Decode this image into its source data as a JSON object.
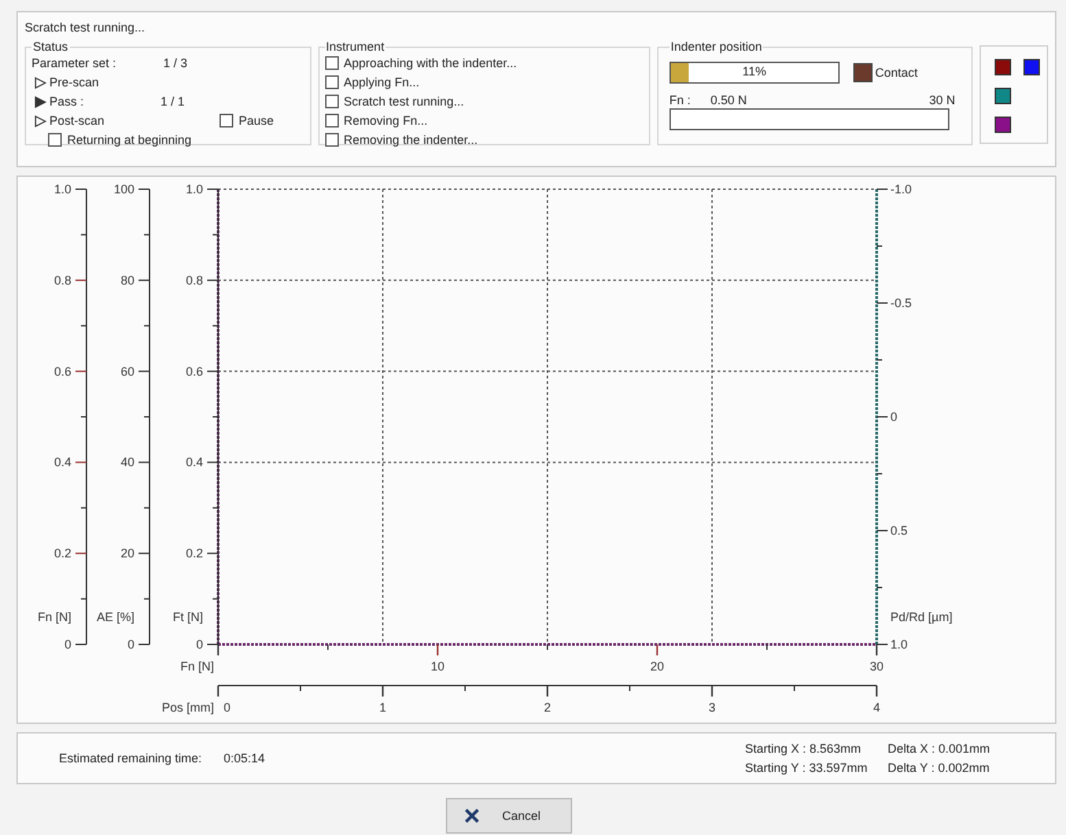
{
  "status_message": "Scratch test running...",
  "status": {
    "title": "Status",
    "parameter_set": {
      "label": "Parameter set :",
      "value": "1 / 3"
    },
    "steps": [
      {
        "label": "Pre-scan",
        "active": false
      },
      {
        "label": "Pass :",
        "value": "1 / 1",
        "active": true
      },
      {
        "label": "Post-scan",
        "active": false
      }
    ],
    "pause": {
      "label": "Pause",
      "checked": false
    },
    "returning": {
      "label": "Returning at beginning",
      "checked": false
    }
  },
  "instrument": {
    "title": "Instrument",
    "items": [
      {
        "label": "Approaching with the indenter...",
        "checked": false
      },
      {
        "label": "Applying Fn...",
        "checked": false
      },
      {
        "label": "Scratch test running...",
        "checked": false
      },
      {
        "label": "Removing Fn...",
        "checked": false
      },
      {
        "label": "Removing the indenter...",
        "checked": false
      }
    ]
  },
  "indenter_position": {
    "title": "Indenter position",
    "level": 0.11,
    "reading": "11%",
    "contact": {
      "label": "Contact",
      "color": "#6b3a2c"
    },
    "fn": {
      "label": "Fn :",
      "min": "0.50  N",
      "max": "30  N"
    }
  },
  "legend_swatches": [
    {
      "color": "#8b0a0a"
    },
    {
      "color": "#1010f0"
    },
    {
      "color": "#108888"
    },
    {
      "color": "#8a108a"
    }
  ],
  "chart": {
    "left_axes": [
      {
        "label": "Fn [N]",
        "ticks": [
          "1.0",
          "0.8",
          "0.6",
          "0.4",
          "0.2",
          "0"
        ]
      },
      {
        "label": "AE [%]",
        "ticks": [
          "100",
          "80",
          "60",
          "40",
          "20",
          "0"
        ]
      },
      {
        "label": "Ft [N]",
        "ticks": [
          "1.0",
          "0.8",
          "0.6",
          "0.4",
          "0.2",
          "0"
        ]
      }
    ],
    "right_axis": {
      "label": "Pd/Rd [µm]",
      "ticks": [
        "-1.0",
        "-0.5",
        "0",
        "0.5",
        "1.0"
      ]
    },
    "bottom_axes": [
      {
        "label": "Fn [N]",
        "labeled_origin": false,
        "ticks": [
          "10",
          "20",
          "30"
        ]
      },
      {
        "label": "Pos [mm]",
        "labeled_origin": true,
        "ticks": [
          "0",
          "1",
          "2",
          "3",
          "4"
        ]
      }
    ]
  },
  "remaining": {
    "label": "Estimated remaining time:",
    "value": "0:05:14"
  },
  "positions": [
    [
      "Starting X : 8.563mm",
      "Delta X : 0.001mm"
    ],
    [
      "Starting Y : 33.597mm",
      "Delta Y : 0.002mm"
    ]
  ],
  "cancel_button": "Cancel"
}
